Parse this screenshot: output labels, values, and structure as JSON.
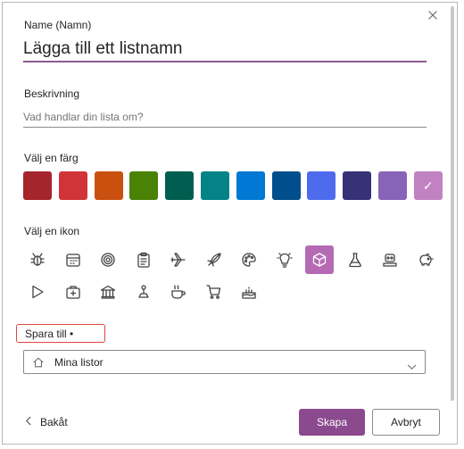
{
  "name_section": {
    "label": "Name (Namn)",
    "value": "Lägga till ett listnamn"
  },
  "description_section": {
    "label": "Beskrivning",
    "placeholder": "Vad handlar din lista om?"
  },
  "color_section": {
    "label": "Välj en färg",
    "colors": [
      "#a4262c",
      "#d13438",
      "#ca5010",
      "#498205",
      "#005e50",
      "#038387",
      "#0078d4",
      "#004e8c",
      "#4f6bed",
      "#373277",
      "#8764b8",
      "#c182c1"
    ],
    "selected_index": 11,
    "selected_mark": "✓"
  },
  "icon_section": {
    "label": "Välj en ikon",
    "icons": [
      "bug-icon",
      "calendar-icon",
      "target-icon",
      "clipboard-icon",
      "airplane-icon",
      "rocket-icon",
      "palette-icon",
      "lightbulb-icon",
      "cube-icon",
      "flask-icon",
      "robot-icon",
      "piggy-bank-icon",
      "play-icon",
      "first-aid-kit-icon",
      "bank-icon",
      "map-pin-icon",
      "coffee-cup-icon",
      "shopping-cart-icon",
      "cake-icon"
    ],
    "selected_icon": "cube-icon",
    "selected_color": "#b46bb4"
  },
  "save_section": {
    "label": "Spara till •",
    "dropdown_value": "Mina listor",
    "dropdown_icon": "home-icon"
  },
  "footer": {
    "back_label": "Bakåt",
    "create_label": "Skapa",
    "cancel_label": "Avbryt",
    "accent": "#8c4a8e"
  },
  "close_icon": "close-icon"
}
